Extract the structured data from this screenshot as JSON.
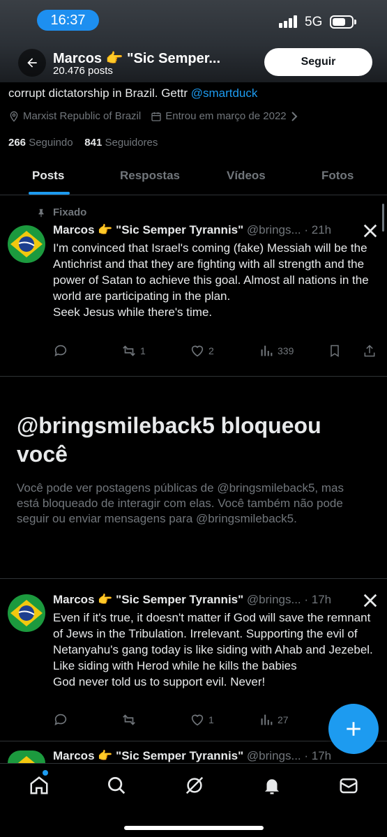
{
  "status_bar": {
    "time": "16:37",
    "network": "5G"
  },
  "header": {
    "name": "Marcos 👉 \"Sic Semper...",
    "posts_count": "20.476 posts",
    "follow_label": "Seguir"
  },
  "profile": {
    "bio_prefix": "corrupt dictatorship in Brazil. Gettr ",
    "bio_link": "@smartduck",
    "location": "Marxist Republic of Brazil",
    "joined": "Entrou em março de 2022",
    "following_count": "266",
    "following_label": "Seguindo",
    "followers_count": "841",
    "followers_label": "Seguidores"
  },
  "tabs": [
    {
      "label": "Posts",
      "active": true
    },
    {
      "label": "Respostas",
      "active": false
    },
    {
      "label": "Vídeos",
      "active": false
    },
    {
      "label": "Fotos",
      "active": false
    }
  ],
  "pinned_label": "Fixado",
  "posts": [
    {
      "name": "Marcos 👉 \"Sic Semper Tyrannis\"",
      "handle": "@brings... · 21h",
      "text": "I'm convinced that Israel's coming (fake) Messiah will be the Antichrist and that they are fighting with all strength and the power of Satan to achieve this goal. Almost all nations in the world are participating in the plan.\nSeek Jesus while there's time.",
      "reposts": "1",
      "likes": "2",
      "views": "339"
    },
    {
      "name": "Marcos 👉 \"Sic Semper Tyrannis\"",
      "handle": "@brings... · 17h",
      "text": "Even if it's true, it doesn't matter if God will save the remnant of Jews in the Tribulation. Irrelevant. Supporting the evil of Netanyahu's gang today is like siding with Ahab and Jezebel. Like siding with Herod while he kills the babies\nGod never told us to support evil. Never!",
      "reposts": "",
      "likes": "1",
      "views": "27"
    },
    {
      "name": "Marcos 👉 \"Sic Semper Tyrannis\"",
      "handle": "@brings... · 17h"
    }
  ],
  "blocked": {
    "title": "@bringsmileback5 bloqueou você",
    "body": "Você pode ver postagens públicas de @bringsmileback5, mas está bloqueado de interagir com elas. Você também não pode seguir ou enviar mensagens para @bringsmileback5."
  },
  "colors": {
    "accent": "#1d9bf0",
    "background": "#000000",
    "muted": "#71767b",
    "text": "#e7e9ea"
  }
}
